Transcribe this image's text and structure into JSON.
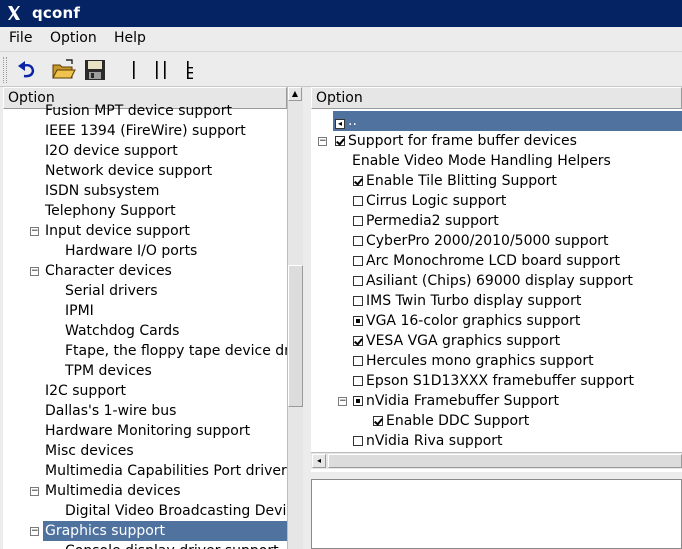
{
  "window": {
    "title": "qconf"
  },
  "menu": {
    "file": "File",
    "option": "Option",
    "help": "Help"
  },
  "toolbar": {
    "icons": [
      "undo-icon",
      "open-icon",
      "save-icon",
      "single-view-icon",
      "split-view-icon",
      "full-view-icon"
    ]
  },
  "left_panel": {
    "header": "Option",
    "items": [
      {
        "label": "Fusion MPT device support",
        "indent": 1,
        "expander": ""
      },
      {
        "label": "IEEE 1394 (FireWire) support",
        "indent": 1,
        "expander": ""
      },
      {
        "label": "I2O device support",
        "indent": 1,
        "expander": ""
      },
      {
        "label": "Network device support",
        "indent": 1,
        "expander": ""
      },
      {
        "label": "ISDN subsystem",
        "indent": 1,
        "expander": ""
      },
      {
        "label": "Telephony Support",
        "indent": 1,
        "expander": ""
      },
      {
        "label": "Input device support",
        "indent": 1,
        "expander": "−"
      },
      {
        "label": "Hardware I/O ports",
        "indent": 2,
        "expander": ""
      },
      {
        "label": "Character devices",
        "indent": 1,
        "expander": "−"
      },
      {
        "label": "Serial drivers",
        "indent": 2,
        "expander": ""
      },
      {
        "label": "IPMI",
        "indent": 2,
        "expander": ""
      },
      {
        "label": "Watchdog Cards",
        "indent": 2,
        "expander": ""
      },
      {
        "label": "Ftape, the floppy tape device driver",
        "indent": 2,
        "expander": ""
      },
      {
        "label": "TPM devices",
        "indent": 2,
        "expander": ""
      },
      {
        "label": "I2C support",
        "indent": 1,
        "expander": ""
      },
      {
        "label": "Dallas's 1-wire bus",
        "indent": 1,
        "expander": ""
      },
      {
        "label": "Hardware Monitoring support",
        "indent": 1,
        "expander": ""
      },
      {
        "label": "Misc devices",
        "indent": 1,
        "expander": ""
      },
      {
        "label": "Multimedia Capabilities Port drivers",
        "indent": 1,
        "expander": ""
      },
      {
        "label": "Multimedia devices",
        "indent": 1,
        "expander": "−"
      },
      {
        "label": "Digital Video Broadcasting Devices",
        "indent": 2,
        "expander": ""
      },
      {
        "label": "Graphics support",
        "indent": 1,
        "expander": "−",
        "selected": true
      },
      {
        "label": "Console display driver support",
        "indent": 2,
        "expander": ""
      }
    ]
  },
  "right_panel": {
    "header": "Option",
    "back_label": "..",
    "items": [
      {
        "label": "Support for frame buffer devices",
        "indent": 0,
        "check": "checked",
        "expander": "−"
      },
      {
        "label": "Enable Video Mode Handling Helpers",
        "indent": 1,
        "check": "",
        "expander": ""
      },
      {
        "label": "Enable Tile Blitting Support",
        "indent": 1,
        "check": "checked",
        "expander": ""
      },
      {
        "label": "Cirrus Logic support",
        "indent": 1,
        "check": "empty",
        "expander": ""
      },
      {
        "label": "Permedia2 support",
        "indent": 1,
        "check": "empty",
        "expander": ""
      },
      {
        "label": "CyberPro 2000/2010/5000 support",
        "indent": 1,
        "check": "empty",
        "expander": ""
      },
      {
        "label": "Arc Monochrome LCD board support",
        "indent": 1,
        "check": "empty",
        "expander": ""
      },
      {
        "label": "Asiliant (Chips) 69000 display support",
        "indent": 1,
        "check": "empty",
        "expander": ""
      },
      {
        "label": "IMS Twin Turbo display support",
        "indent": 1,
        "check": "empty",
        "expander": ""
      },
      {
        "label": "VGA 16-color graphics support",
        "indent": 1,
        "check": "mod",
        "expander": ""
      },
      {
        "label": "VESA VGA graphics support",
        "indent": 1,
        "check": "checked",
        "expander": ""
      },
      {
        "label": "Hercules mono graphics support",
        "indent": 1,
        "check": "empty",
        "expander": ""
      },
      {
        "label": "Epson S1D13XXX framebuffer support",
        "indent": 1,
        "check": "empty",
        "expander": ""
      },
      {
        "label": "nVidia Framebuffer Support",
        "indent": 1,
        "check": "mod",
        "expander": "−"
      },
      {
        "label": "Enable DDC Support",
        "indent": 2,
        "check": "checked",
        "expander": ""
      },
      {
        "label": "nVidia Riva support",
        "indent": 1,
        "check": "empty",
        "expander": ""
      }
    ]
  }
}
